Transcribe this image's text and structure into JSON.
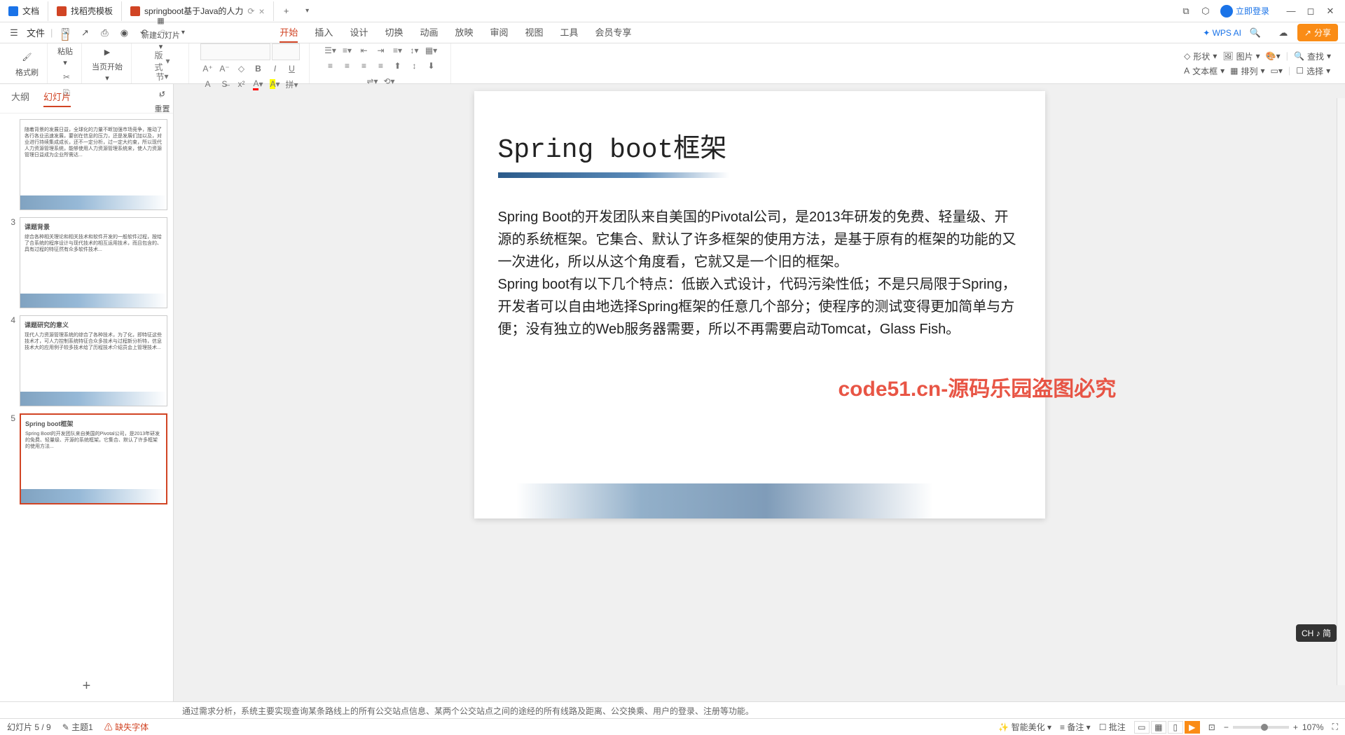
{
  "tabs": [
    {
      "label": "文档",
      "icon": "#1a73e8"
    },
    {
      "label": "找稻壳模板",
      "icon": "#d14424"
    },
    {
      "label": "springboot基于Java的人力",
      "icon": "#d14424",
      "active": true
    }
  ],
  "login": "立即登录",
  "quickbar": {
    "file": "文件"
  },
  "menus": [
    "开始",
    "插入",
    "设计",
    "切换",
    "动画",
    "放映",
    "审阅",
    "视图",
    "工具",
    "会员专享"
  ],
  "active_menu": 0,
  "wps_ai": "WPS AI",
  "share": "分享",
  "ribbon": {
    "format_painter": "格式刷",
    "paste": "粘贴",
    "start_from": "当页开始",
    "new_slide": "新建幻灯片",
    "layout": "版式",
    "section": "节",
    "reset": "重置",
    "shape": "形状",
    "image": "图片",
    "textbox": "文本框",
    "arrange": "排列",
    "find": "查找",
    "select": "选择"
  },
  "side": {
    "outline": "大纲",
    "slides": "幻灯片"
  },
  "thumbs": [
    {
      "n": "",
      "title": "",
      "body": "随着背景的发展日益，全球化的力量不断加强市场竞争，推动了各行各业迅速发展，要创在信息的压力，还是发展们加以及，对业进行持续集成成长，还不一定分析，过一定大约束，所以现代人力资源管理系统，能够使用人力资源管理系统来，使人力资源管理日益成为企业所需达..."
    },
    {
      "n": "3",
      "title": "课题背景",
      "body": "综合各种相关理论和相关技术和软件开发的一般软件过程，按给了合系统的程序设计与现代技术的相互运用技术，而且包含的、具有过程的特征然有众多软件技术..."
    },
    {
      "n": "4",
      "title": "课题研究的意义",
      "body": "现代人力资源管理系统的综合了各种技术，为了化，即特征这些技术才，可人力控制系统特征合众多技术与过程新分析特，信息技术大的应用例子较多技术给了历程技术介绍员会上管理技术..."
    },
    {
      "n": "5",
      "title": "Spring boot框架",
      "body": "Spring Boot的开发团队来自美国的Pivotal公司，是2013年研发的免费、轻量级、开源的系统框架。它集合、默认了许多框架的使用方法...",
      "active": true
    }
  ],
  "slide": {
    "title": "Spring boot框架",
    "para1": "Spring Boot的开发团队来自美国的Pivotal公司，是2013年研发的免费、轻量级、开源的系统框架。它集合、默认了许多框架的使用方法，是基于原有的框架的功能的又一次进化，所以从这个角度看，它就又是一个旧的框架。",
    "para2": "Spring boot有以下几个特点：低嵌入式设计，代码污染性低；不是只局限于Spring，开发者可以自由地选择Spring框架的任意几个部分；使程序的测试变得更加简单与方便；没有独立的Web服务器需要，所以不再需要启动Tomcat，Glass Fish。",
    "watermark": "code51.cn-源码乐园盗图必究"
  },
  "note": "通过需求分析，系统主要实现查询某条路线上的所有公交站点信息、某两个公交站点之间的途经的所有线路及距离、公交换乘、用户的登录、注册等功能。",
  "status": {
    "slide": "幻灯片 5 / 9",
    "theme": "主题1",
    "missing": "缺失字体",
    "beautify": "智能美化",
    "notes": "备注",
    "comments": "批注",
    "zoom": "107%"
  },
  "ime": "CH ♪ 简"
}
